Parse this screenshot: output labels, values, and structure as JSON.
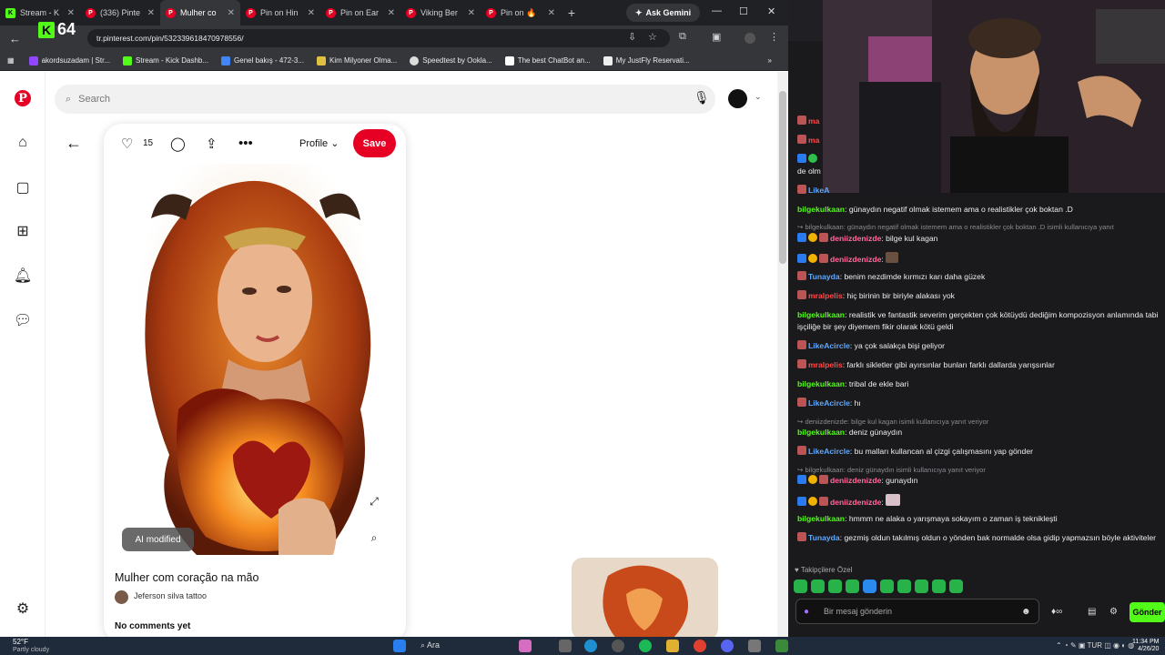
{
  "browser": {
    "tabs": [
      {
        "label": "Stream - K",
        "icon": "kick"
      },
      {
        "label": "(336) Pinte",
        "icon": "pinterest"
      },
      {
        "label": "Mulher co",
        "icon": "pinterest",
        "active": true
      },
      {
        "label": "Pin on Hin",
        "icon": "pinterest"
      },
      {
        "label": "Pin on Ear",
        "icon": "pinterest"
      },
      {
        "label": "Viking Ber",
        "icon": "pinterest"
      },
      {
        "label": "Pin on 🔥",
        "icon": "pinterest"
      }
    ],
    "ask_gemini": "Ask Gemini",
    "url": "tr.pinterest.com/pin/532339618470978556/",
    "bookmarks": [
      "akordsuzadam | Str...",
      "Stream - Kick Dashb...",
      "Genel bakış - 472-3...",
      "Kim Milyoner Olma...",
      "Speedtest by Ookla...",
      "The best ChatBot an...",
      "My JustFly Reservati..."
    ]
  },
  "overlay": {
    "viewer_count": "64"
  },
  "pinterest": {
    "search_placeholder": "Search",
    "like_count": "15",
    "profile_label": "Profile",
    "save_label": "Save",
    "ai_badge": "AI modified",
    "pin_title": "Mulher com coração na mão",
    "author": "Jeferson silva tattoo",
    "comments_status": "No comments yet",
    "brand_color": "#e60023"
  },
  "chat": {
    "messages": [
      {
        "user": "bilgekulkaan",
        "text": ": günaydın negatif olmak istemem ama o realistikler çok boktan .D"
      },
      {
        "reply": "bilgekulkaan: günaydın negatif olmak istemem ama o realistikler çok boktan .D isimli kullanıcıya yanıt"
      },
      {
        "user": "deniizdenizde",
        "text": ": bilge kul kagan"
      },
      {
        "user": "deniizdenizde",
        "text": ":"
      },
      {
        "user": "Tunayda",
        "text": ": benim nezdimde kırmızı karı daha güzek"
      },
      {
        "user": "mralpelis",
        "text": ": hiç birinin bir biriyle alakası yok"
      },
      {
        "user": "bilgekulkaan",
        "text": ": realistik ve fantastik severim gerçekten çok kötüydü dediğim kompozisyon anlamında tabi işçiliğe bir şey diyemem fikir olarak kötü geldi"
      },
      {
        "user": "LikeAcircle",
        "text": ": ya çok salakça bişi geliyor"
      },
      {
        "user": "mralpelis",
        "text": ": farklı sikletler gibi ayırsınlar bunları farklı dallarda yarışsınlar"
      },
      {
        "user": "bilgekulkaan",
        "text": ": tribal de ekle bari"
      },
      {
        "user": "LikeAcircle",
        "text": ": hı"
      },
      {
        "reply": "deniizdenizde: bilge kul kagan isimli kullanıcıya yanıt veriyor"
      },
      {
        "user": "bilgekulkaan",
        "text": ": deniz günaydın"
      },
      {
        "user": "LikeAcircle",
        "text": ": bu malları kullancan al çizgi çalışmasını yap gönder"
      },
      {
        "reply": "bilgekulkaan: deniz günaydın isimli kullanıcıya yanıt veriyor"
      },
      {
        "user": "deniizdenizde",
        "text": ": gunaydın"
      },
      {
        "user": "deniizdenizde",
        "text": ":"
      },
      {
        "user": "bilgekulkaan",
        "text": ": hmmm ne alaka o yarışmaya sokayım o zaman iş teknikleşti"
      },
      {
        "user": "Tunayda",
        "text": ": gezmiş oldun takılmış oldun o yönden bak normalde olsa gidip yapmazsın böyle aktiviteler"
      }
    ],
    "top_partial": {
      "text": "de olm",
      "partial_user": "LikeA"
    },
    "followers_label": "Takipçilere Özel",
    "input_placeholder": "Bir mesaj gönderin",
    "send_label": "Gönder"
  },
  "taskbar": {
    "weather_temp": "52°F",
    "weather_desc": "Partly cloudy",
    "search_label": "Ara",
    "lang": "TUR",
    "time": "11:34 PM",
    "date": "4/26/20"
  }
}
